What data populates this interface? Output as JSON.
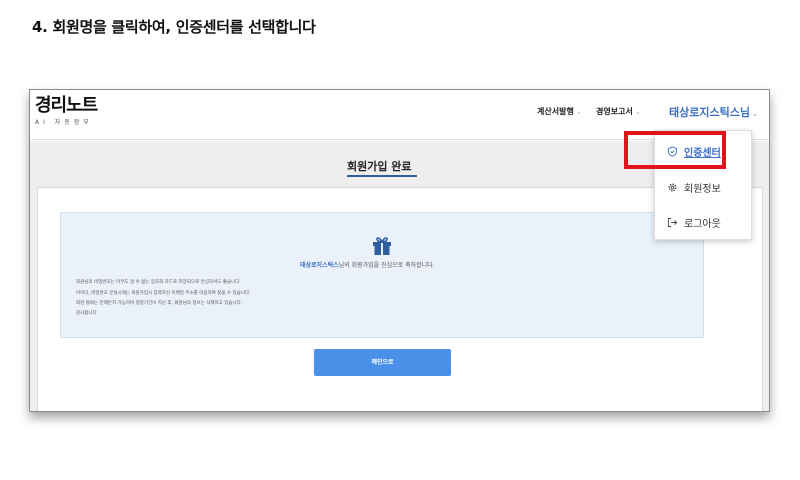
{
  "instruction": "4. 회원명을 클릭하여, 인증센터를 선택합니다",
  "header": {
    "logo": "경리노트",
    "logo_sub": "AI 자동장부",
    "nav": [
      {
        "label": "계산서발행"
      },
      {
        "label": "경영보고서"
      }
    ],
    "user_menu": "태상로지스틱스님"
  },
  "page_title": "회원가입 완료",
  "message": {
    "user_name": "태상로지스틱스",
    "congrats": "님의 회원가입을 진심으로 축하합니다.",
    "notes": [
      "회원님의 비밀번호는 아무도 알 수 없는 암호화 코드로 저장되므로 안심하셔도 좋습니다.",
      "아이디, 비밀번호 분실시에는 회원가입시 입력하신 이메일 주소를 이용하여 찾을 수 있습니다.",
      "회원 탈퇴는 언제든지 가능하며 일정기간이 지난 후, 회원님의 정보는 삭제하고 있습니다.",
      "감사합니다."
    ]
  },
  "main_button": "메인으로",
  "dropdown": {
    "items": [
      {
        "label": "인증센터",
        "icon": "shield-icon"
      },
      {
        "label": "회원정보",
        "icon": "gear-icon"
      },
      {
        "label": "로그아웃",
        "icon": "logout-icon"
      }
    ]
  },
  "colors": {
    "accent": "#3a6fc2",
    "button": "#4a8fe8",
    "highlight": "#e0141a",
    "message_bg": "#eaf1fa"
  }
}
